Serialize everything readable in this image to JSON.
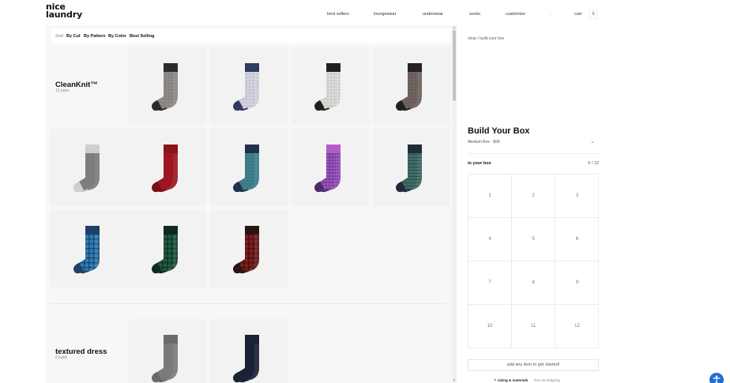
{
  "brand": {
    "line1": "nice",
    "line2": "laundry"
  },
  "nav": {
    "items": [
      "best sellers",
      "loungewear",
      "underwear",
      "socks",
      "customize"
    ],
    "cart_label": "cart",
    "cart_count": "0"
  },
  "sort": {
    "label": "Sort",
    "options": [
      "By Cut",
      "By Pattern",
      "By Color",
      "Best Selling"
    ]
  },
  "groups": [
    {
      "title": "CleanKnit™",
      "count": "13 pairs",
      "products": [
        {
          "body": "#8e8a86",
          "top": "#2b2b2b",
          "toe": "#2b2b2b",
          "pattern": "dots"
        },
        {
          "body": "#d3d1df",
          "top": "#2e3c5e",
          "toe": "#2e3c5e",
          "pattern": "dots"
        },
        {
          "body": "#d9d9d6",
          "top": "#1f1f1f",
          "toe": "#1f1f1f",
          "pattern": "dots"
        },
        {
          "body": "#6f6360",
          "top": "#222222",
          "toe": "#222222",
          "pattern": "dots"
        },
        {
          "body": "#7d7d7d",
          "top": "#cfcfcf",
          "toe": "#cfcfcf",
          "pattern": "plain"
        },
        {
          "body": "#9e1620",
          "top": "#8a131c",
          "toe": "#7a1018",
          "pattern": "plain"
        },
        {
          "body": "#3f7f8c",
          "top": "#22304a",
          "toe": "#22304a",
          "pattern": "dots"
        },
        {
          "body": "#7a3da0",
          "top": "#b35cc8",
          "toe": "#4a2b6a",
          "pattern": "paisley"
        },
        {
          "body": "#3f6b66",
          "top": "#1f2a3a",
          "toe": "#1f2a3a",
          "pattern": "stripe"
        },
        {
          "body": "#2e7bb6",
          "top": "#1e3f66",
          "toe": "#1e3f66",
          "pattern": "plaid"
        },
        {
          "body": "#1f5a40",
          "top": "#0f2a22",
          "toe": "#0f2a22",
          "pattern": "plaid"
        },
        {
          "body": "#7a1e1e",
          "top": "#2a1414",
          "toe": "#2a1414",
          "pattern": "plaid"
        }
      ]
    },
    {
      "title": "textured dress",
      "count": "2 pairs",
      "products": [
        {
          "body": "#7a7a7a",
          "top": "#6a6a6a",
          "toe": "#6a6a6a",
          "pattern": "plain"
        },
        {
          "body": "#1c2236",
          "top": "#1c2236",
          "toe": "#1c2236",
          "pattern": "plain"
        }
      ]
    }
  ],
  "box": {
    "breadcrumb": "shop / build your box",
    "title": "Build Your Box",
    "selected_box": "Medium Box - $99",
    "in_box_label": "in your box",
    "in_box_count": "0 / 12",
    "slots": [
      "1",
      "2",
      "3",
      "4",
      "5",
      "6",
      "7",
      "8",
      "9",
      "10",
      "11",
      "12"
    ],
    "cta": "add any item to get started!",
    "footer_link": "sizing & materials",
    "footer_note": "free US shipping"
  },
  "colors": {
    "accent": "#1f6ed4",
    "panel_bg": "#f7f7f7"
  }
}
